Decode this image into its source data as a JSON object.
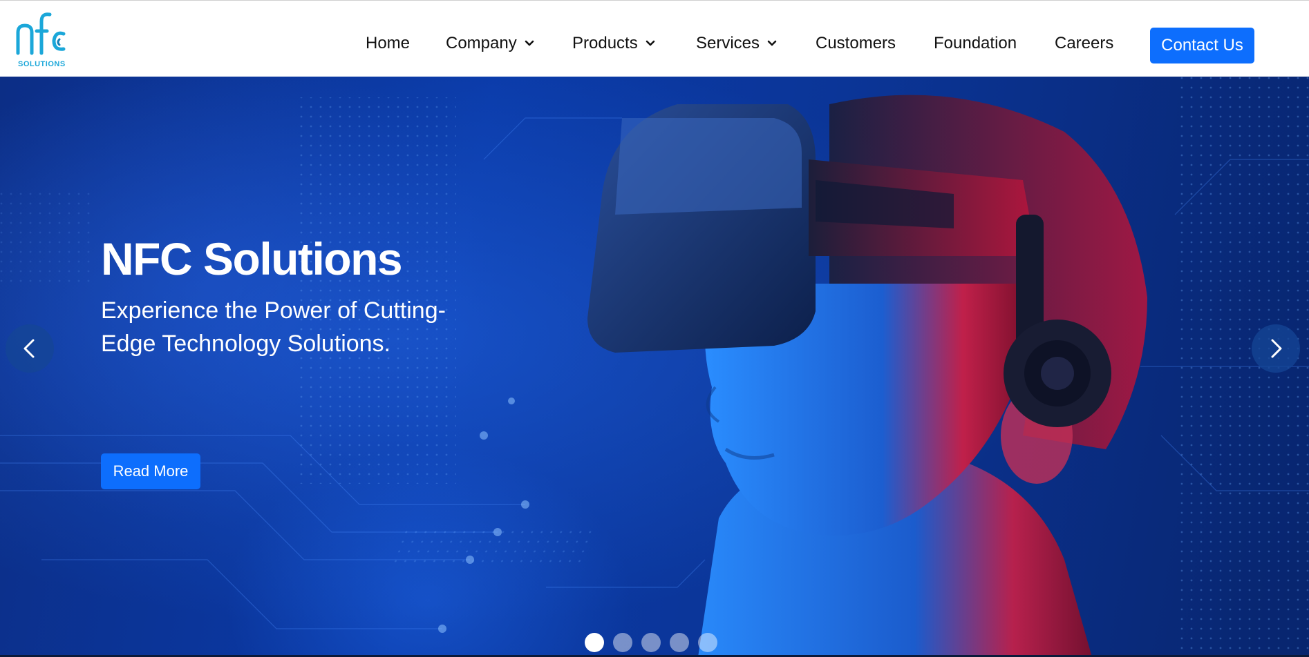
{
  "brand": {
    "logo_text": "nfc",
    "logo_sub": "SOLUTIONS",
    "accent": "#0d6efd",
    "logo_color": "#1ba7d9"
  },
  "nav": {
    "items": [
      {
        "label": "Home",
        "has_dropdown": false
      },
      {
        "label": "Company",
        "has_dropdown": true
      },
      {
        "label": "Products",
        "has_dropdown": true
      },
      {
        "label": "Services",
        "has_dropdown": true
      },
      {
        "label": "Customers",
        "has_dropdown": false
      },
      {
        "label": "Foundation",
        "has_dropdown": false
      },
      {
        "label": "Careers",
        "has_dropdown": false
      }
    ],
    "contact_label": "Contact Us"
  },
  "hero": {
    "title": "NFC Solutions",
    "subtitle": "Experience the Power of Cutting-Edge Technology Solutions.",
    "cta_label": "Read More",
    "prev_icon": "chevron-left-icon",
    "next_icon": "chevron-right-icon",
    "slide_count": 5,
    "active_slide": 1
  }
}
